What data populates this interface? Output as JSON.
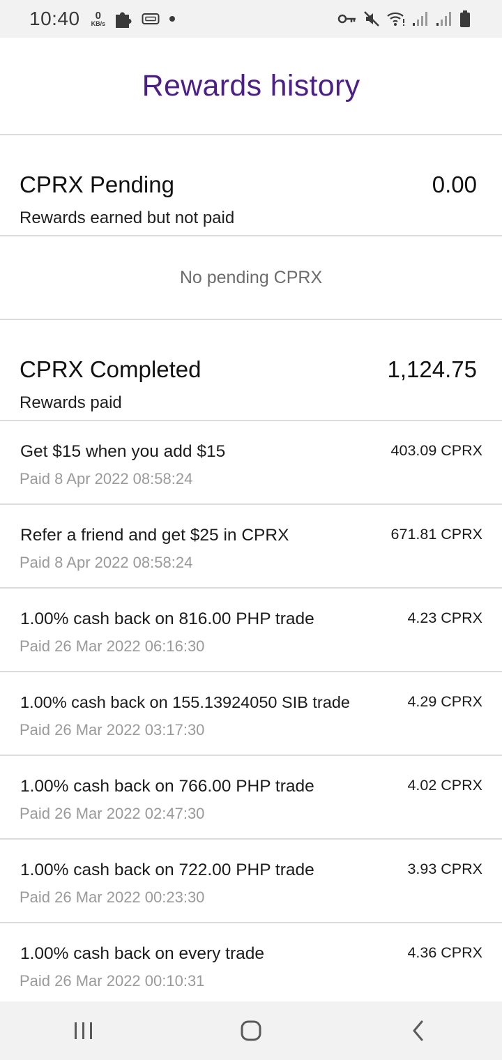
{
  "status_bar": {
    "time": "10:40",
    "net_speed_value": "0",
    "net_speed_unit": "KB/s",
    "icons": [
      "puzzle-icon",
      "sim-card-icon",
      "dot-icon",
      "vpn-key-icon",
      "mute-icon",
      "wifi-icon",
      "signal-icon",
      "signal-icon",
      "battery-icon"
    ]
  },
  "header": {
    "title": "Rewards history"
  },
  "pending": {
    "title": "CPRX Pending",
    "amount": "0.00",
    "subtitle": "Rewards earned but not paid",
    "empty_text": "No pending CPRX"
  },
  "completed": {
    "title": "CPRX Completed",
    "amount": "1,124.75",
    "subtitle": "Rewards paid",
    "items": [
      {
        "description": "Get $15 when you add $15",
        "date": "Paid 8 Apr 2022 08:58:24",
        "amount": "403.09 CPRX"
      },
      {
        "description": "Refer a friend and get $25 in CPRX",
        "date": "Paid 8 Apr 2022 08:58:24",
        "amount": "671.81 CPRX"
      },
      {
        "description": "1.00% cash back on 816.00 PHP trade",
        "date": "Paid 26 Mar 2022 06:16:30",
        "amount": "4.23 CPRX"
      },
      {
        "description": "1.00% cash back on 155.13924050 SIB trade",
        "date": "Paid 26 Mar 2022 03:17:30",
        "amount": "4.29 CPRX"
      },
      {
        "description": "1.00% cash back on 766.00 PHP trade",
        "date": "Paid 26 Mar 2022 02:47:30",
        "amount": "4.02 CPRX"
      },
      {
        "description": "1.00% cash back on 722.00 PHP trade",
        "date": "Paid 26 Mar 2022 00:23:30",
        "amount": "3.93 CPRX"
      },
      {
        "description": "1.00% cash back on every trade",
        "date": "Paid 26 Mar 2022 00:10:31",
        "amount": "4.36 CPRX"
      }
    ]
  },
  "nav_bar": {
    "buttons": [
      "recent-apps-icon",
      "home-icon",
      "back-icon"
    ]
  },
  "colors": {
    "title": "#4b1f85",
    "divider": "#dcdcdc",
    "muted": "#9a9a9a",
    "bars": "#f2f2f2"
  }
}
